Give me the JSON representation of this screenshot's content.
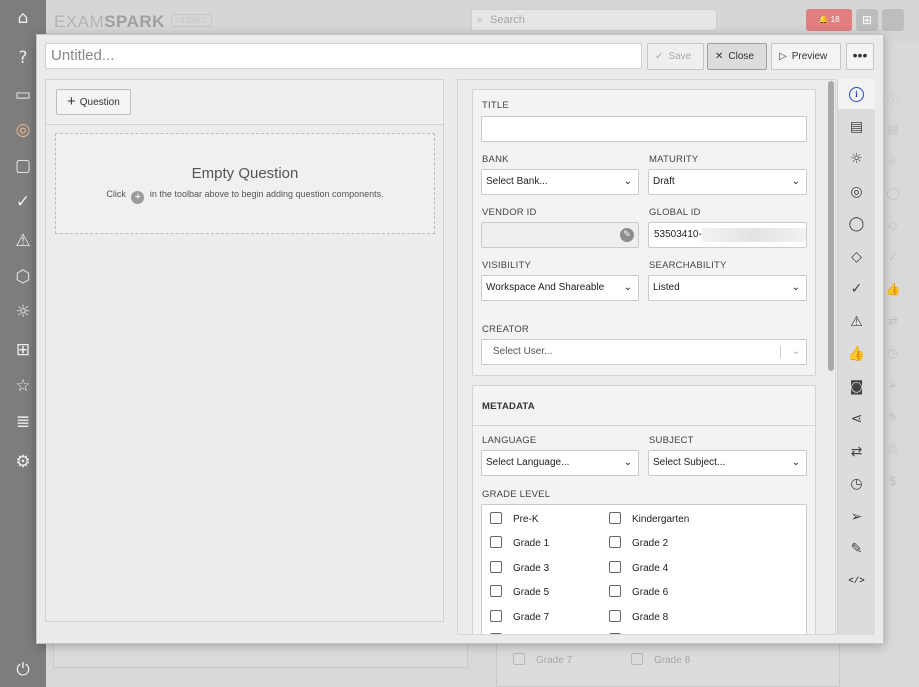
{
  "background": {
    "logo_plain": "EXAM",
    "logo_bold": "SPARK",
    "version": "v3.296.1",
    "search_placeholder": "Search",
    "notifications": "18",
    "rail_icons": [
      "home-icon",
      "help-icon",
      "image-icon",
      "target-icon",
      "folder-icon",
      "check-circle-icon",
      "warning-icon",
      "cube-icon",
      "lightbulb-icon",
      "network-icon",
      "award-icon",
      "server-icon",
      "settings-icon",
      "power-icon"
    ],
    "lower_checkboxes": [
      "Grade 7",
      "Grade 8"
    ]
  },
  "toolbar": {
    "title_placeholder": "Untitled...",
    "save_label": "Save",
    "close_label": "Close",
    "preview_label": "Preview",
    "more_label": "•••"
  },
  "left_pane": {
    "add_question_label": "Question",
    "empty_title": "Empty Question",
    "empty_hint_before": "Click",
    "empty_hint_after": "in the toolbar above to begin adding question components."
  },
  "form": {
    "title_label": "TITLE",
    "title_value": "",
    "bank_label": "BANK",
    "bank_value": "Select Bank...",
    "maturity_label": "MATURITY",
    "maturity_value": "Draft",
    "vendor_id_label": "VENDOR ID",
    "vendor_id_value": "",
    "global_id_label": "GLOBAL ID",
    "global_id_value": "53503410-",
    "visibility_label": "VISIBILITY",
    "visibility_value": "Workspace And Shareable",
    "searchability_label": "SEARCHABILITY",
    "searchability_value": "Listed",
    "creator_label": "CREATOR",
    "creator_placeholder": "Select User..."
  },
  "metadata": {
    "heading": "METADATA",
    "language_label": "LANGUAGE",
    "language_value": "Select Language...",
    "subject_label": "SUBJECT",
    "subject_value": "Select Subject...",
    "grade_level_label": "GRADE LEVEL",
    "grades": [
      "Pre-K",
      "Kindergarten",
      "Grade 1",
      "Grade 2",
      "Grade 3",
      "Grade 4",
      "Grade 5",
      "Grade 6",
      "Grade 7",
      "Grade 8"
    ]
  },
  "side_tabs": [
    "info-icon",
    "book-icon",
    "lightbulb-icon",
    "target-icon",
    "comment-icon",
    "tag-icon",
    "check-circle-icon",
    "warning-icon",
    "thumbs-up-icon",
    "camera-icon",
    "share-icon",
    "swap-icon",
    "clock-icon",
    "send-icon",
    "paperclip-icon",
    "code-icon"
  ],
  "colors": {
    "accent": "#2a45c8",
    "brand": "#f08a3c",
    "notification": "#e07e80"
  }
}
